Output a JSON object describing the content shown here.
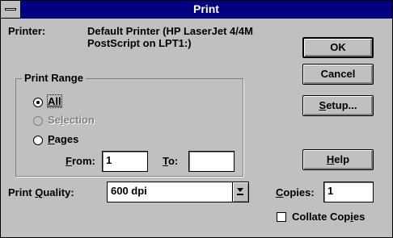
{
  "window": {
    "title": "Print"
  },
  "printer": {
    "label": "Printer:",
    "value_line1": "Default Printer (HP LaserJet 4/4M",
    "value_line2": "PostScript on LPT1:)"
  },
  "print_range": {
    "title": "Print Range",
    "all": {
      "label": "All",
      "checked": true
    },
    "selection": {
      "label": "Selection",
      "checked": false,
      "enabled": false
    },
    "pages": {
      "label": "Pages",
      "checked": false
    },
    "from_label": "From:",
    "from_value": "1",
    "to_label": "To:",
    "to_value": ""
  },
  "quality": {
    "label": "Print Quality:",
    "selected": "600 dpi"
  },
  "copies": {
    "label": "Copies:",
    "value": "1"
  },
  "collate": {
    "label": "Collate Copies",
    "checked": false
  },
  "buttons": {
    "ok": "OK",
    "cancel": "Cancel",
    "setup": "Setup...",
    "help": "Help"
  },
  "icons": {
    "system_menu": "system-menu-icon",
    "dropdown": "chevron-down-icon"
  }
}
